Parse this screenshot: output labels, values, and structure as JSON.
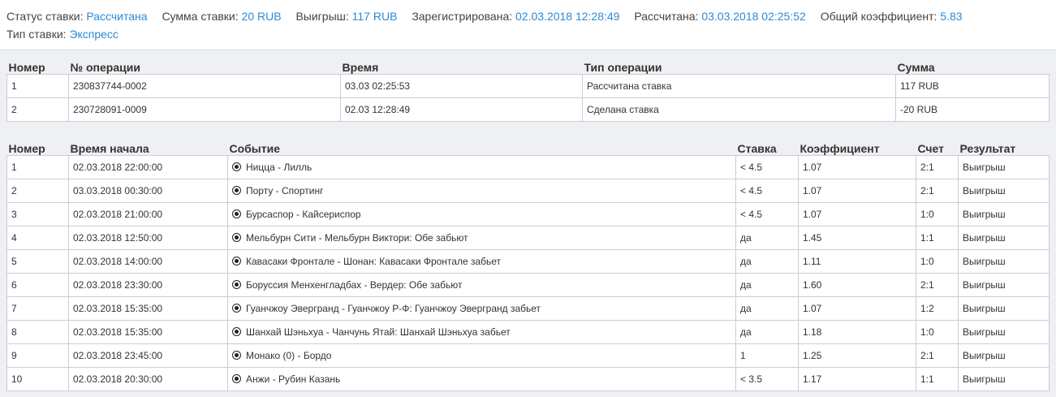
{
  "summary": {
    "status_label": "Статус ставки:",
    "status_value": "Рассчитана",
    "amount_label": "Сумма ставки:",
    "amount_value": "20 RUB",
    "win_label": "Выигрыш:",
    "win_value": "117 RUB",
    "registered_label": "Зарегистрирована:",
    "registered_value": "02.03.2018 12:28:49",
    "settled_label": "Рассчитана:",
    "settled_value": "03.03.2018 02:25:52",
    "coef_label": "Общий коэффициент:",
    "coef_value": "5.83",
    "type_label": "Тип ставки:",
    "type_value": "Экспресс"
  },
  "operations": {
    "headers": [
      "Номер",
      "№ операции",
      "Время",
      "Тип операции",
      "Сумма"
    ],
    "rows": [
      [
        "1",
        "230837744-0002",
        "03.03 02:25:53",
        "Рассчитана ставка",
        "117 RUB"
      ],
      [
        "2",
        "230728091-0009",
        "02.03 12:28:49",
        "Сделана ставка",
        "-20 RUB"
      ]
    ]
  },
  "events": {
    "headers": [
      "Номер",
      "Время начала",
      "Событие",
      "Ставка",
      "Коэффициент",
      "Счет",
      "Результат"
    ],
    "icon": "soccer-ball-icon",
    "rows": [
      [
        "1",
        "02.03.2018 22:00:00",
        "Ницца - Лилль",
        "< 4.5",
        "1.07",
        "2:1",
        "Выигрыш"
      ],
      [
        "2",
        "03.03.2018 00:30:00",
        "Порту - Спортинг",
        "< 4.5",
        "1.07",
        "2:1",
        "Выигрыш"
      ],
      [
        "3",
        "02.03.2018 21:00:00",
        "Бурсаспор - Кайсериспор",
        "< 4.5",
        "1.07",
        "1:0",
        "Выигрыш"
      ],
      [
        "4",
        "02.03.2018 12:50:00",
        "Мельбурн Сити - Мельбурн Виктори: Обе забьют",
        "да",
        "1.45",
        "1:1",
        "Выигрыш"
      ],
      [
        "5",
        "02.03.2018 14:00:00",
        "Кавасаки Фронтале - Шонан: Кавасаки Фронтале забьет",
        "да",
        "1.11",
        "1:0",
        "Выигрыш"
      ],
      [
        "6",
        "02.03.2018 23:30:00",
        "Боруссия Менхенгладбах - Вердер: Обе забьют",
        "да",
        "1.60",
        "2:1",
        "Выигрыш"
      ],
      [
        "7",
        "02.03.2018 15:35:00",
        "Гуанчжоу Эвергранд - Гуанчжоу Р-Ф: Гуанчжоу Эвергранд забьет",
        "да",
        "1.07",
        "1:2",
        "Выигрыш"
      ],
      [
        "8",
        "02.03.2018 15:35:00",
        "Шанхай Шэньхуа - Чанчунь Ятай: Шанхай Шэньхуа забьет",
        "да",
        "1.18",
        "1:0",
        "Выигрыш"
      ],
      [
        "9",
        "02.03.2018 23:45:00",
        "Монако (0) - Бордо",
        "1",
        "1.25",
        "2:1",
        "Выигрыш"
      ],
      [
        "10",
        "02.03.2018 20:30:00",
        "Анжи - Рубин Казань",
        "< 3.5",
        "1.17",
        "1:1",
        "Выигрыш"
      ]
    ]
  },
  "colors": {
    "link": "#2c8ad6",
    "win": "#3a8a1f",
    "background": "#eef0f3"
  }
}
